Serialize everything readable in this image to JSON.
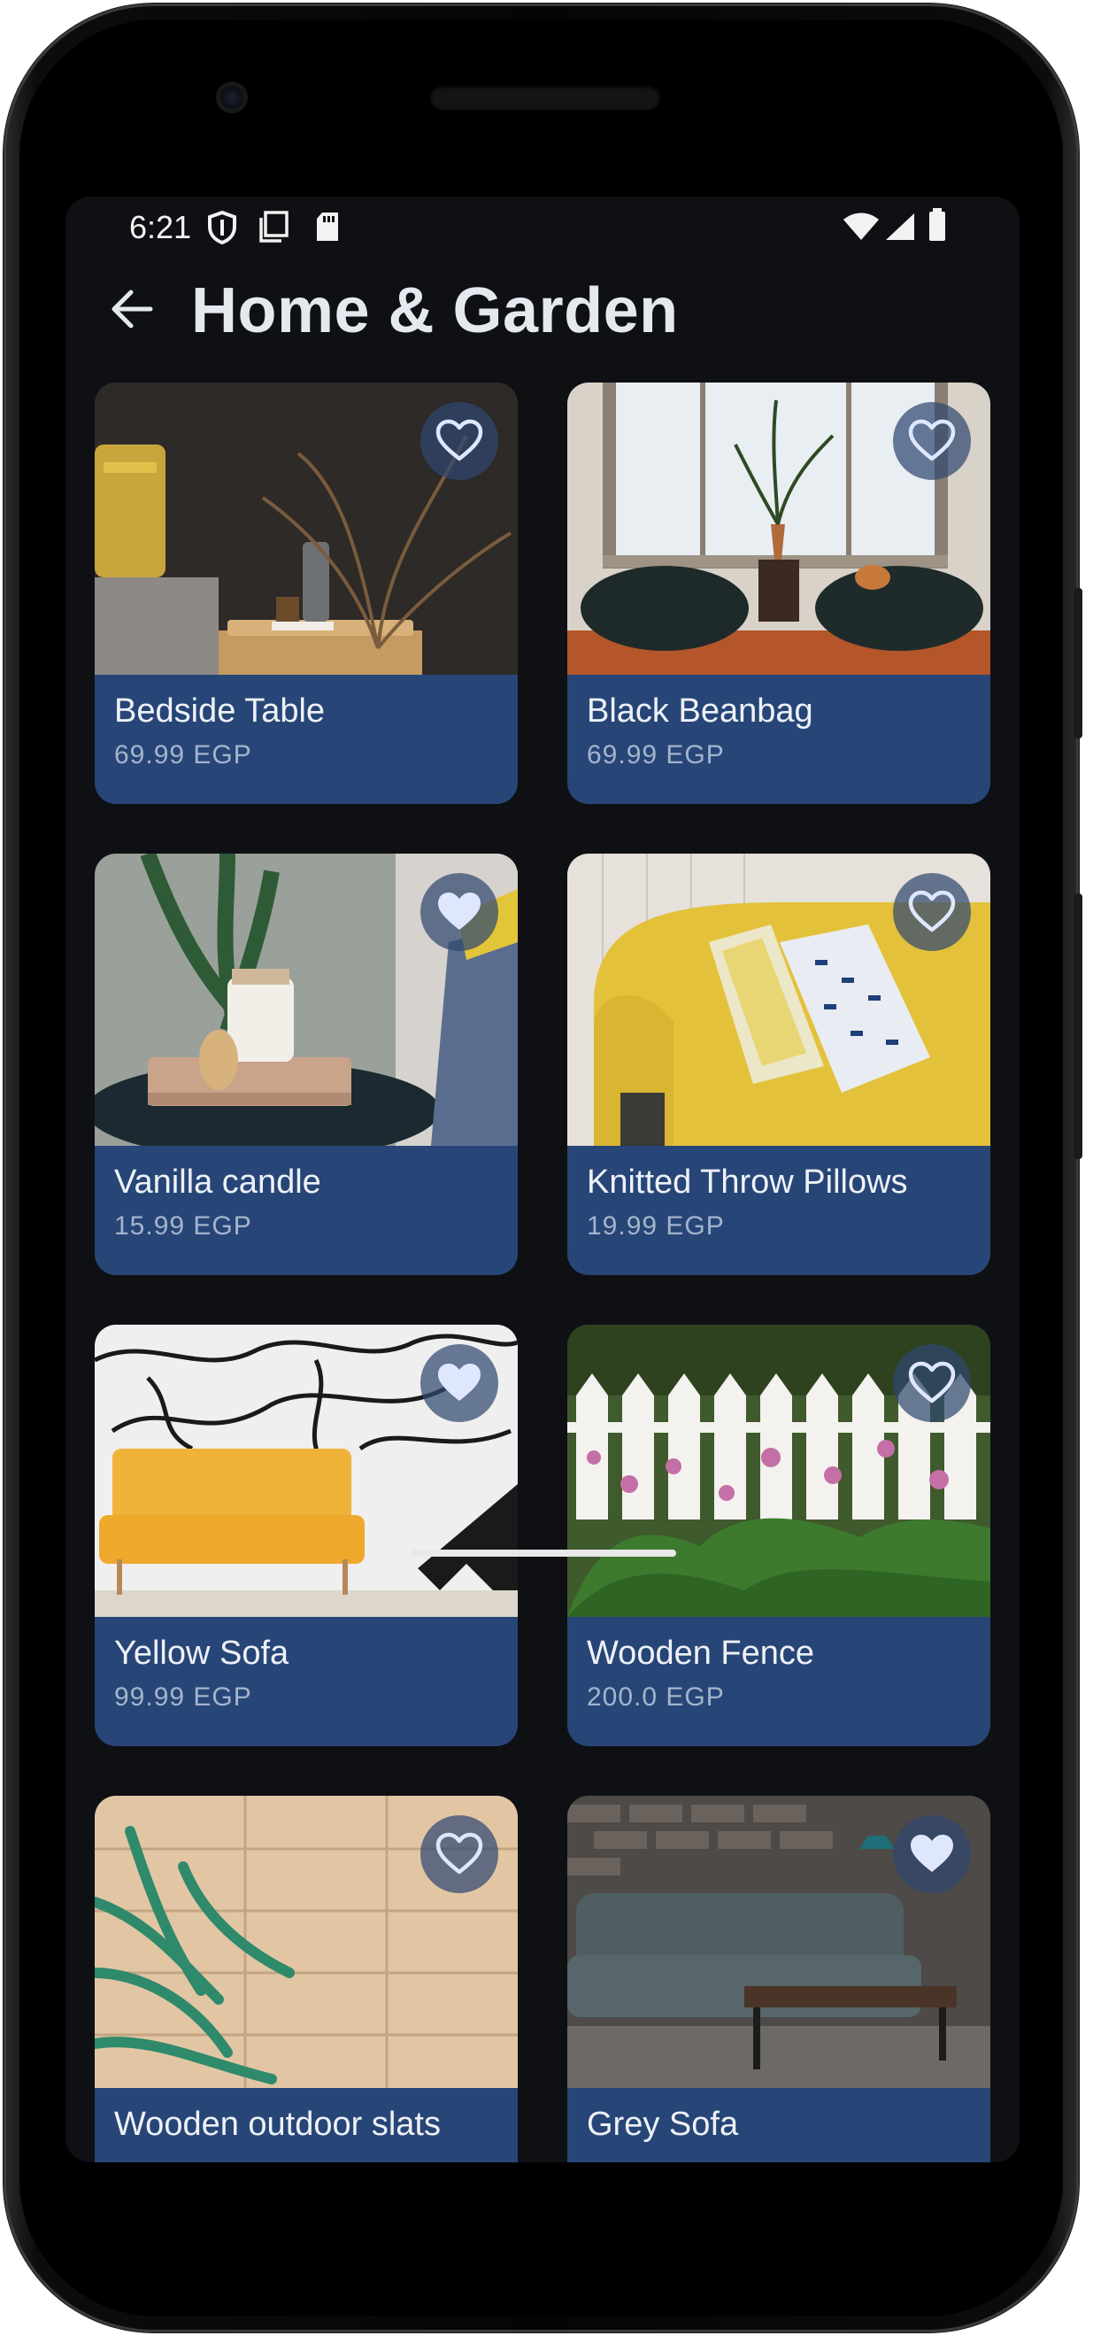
{
  "status_bar": {
    "time": "6:21",
    "icons": [
      "shield-icon",
      "screenshot-icon",
      "sd-card-icon",
      "wifi-icon",
      "signal-icon",
      "battery-icon"
    ]
  },
  "app_bar": {
    "title": "Home & Garden",
    "back_icon": "arrow-back-icon"
  },
  "colors": {
    "background": "#0f1014",
    "card": "#274677",
    "price_text": "#a6b3cc",
    "favorite_bg": "#304870",
    "favorite_icon": "#dfe7ff"
  },
  "products": [
    {
      "name": "Bedside Table",
      "price": "69.99 EGP",
      "favorited": false
    },
    {
      "name": "Black Beanbag",
      "price": "69.99 EGP",
      "favorited": false
    },
    {
      "name": "Vanilla candle",
      "price": "15.99 EGP",
      "favorited": true
    },
    {
      "name": "Knitted Throw Pillows",
      "price": "19.99 EGP",
      "favorited": false
    },
    {
      "name": "Yellow Sofa",
      "price": "99.99 EGP",
      "favorited": true
    },
    {
      "name": "Wooden Fence",
      "price": "200.0 EGP",
      "favorited": false
    },
    {
      "name": "Wooden outdoor slats",
      "price": "",
      "favorited": false
    },
    {
      "name": "Grey Sofa",
      "price": "",
      "favorited": true
    }
  ]
}
